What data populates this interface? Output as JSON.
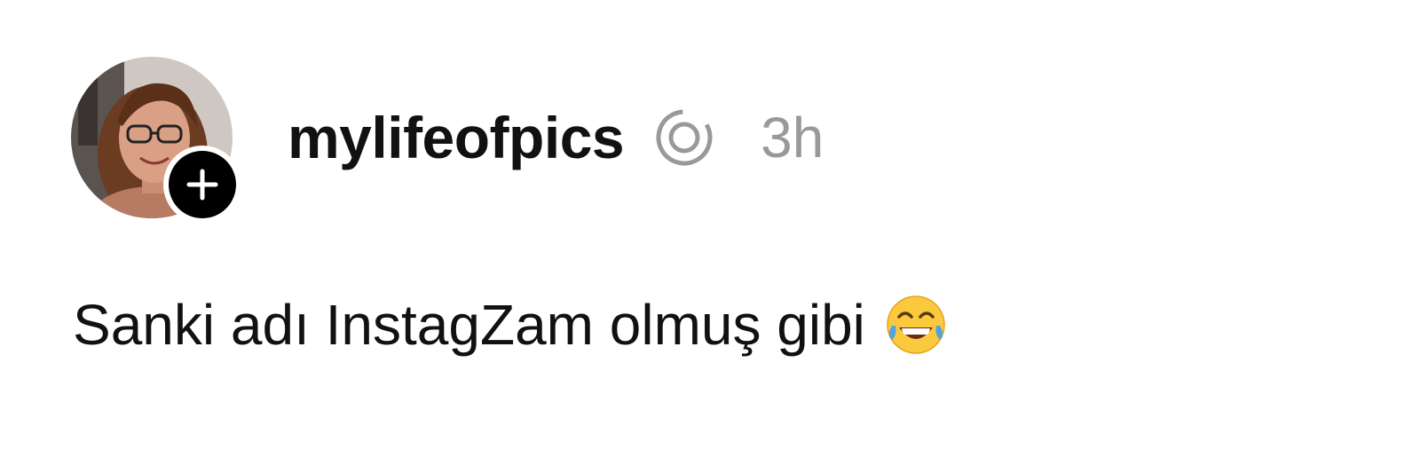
{
  "post": {
    "username": "mylifeofpics",
    "timestamp": "3h",
    "text": "Sanki adı InstagZam olmuş gibi",
    "emoji": "face-with-tears-of-joy",
    "icons": {
      "avatar": "profile-photo",
      "follow": "plus-icon",
      "threads": "threads-icon"
    }
  },
  "colors": {
    "username": "#111111",
    "timestamp": "#999999",
    "text": "#111111",
    "follow_badge": "#000000",
    "threads_icon": "#999999"
  }
}
